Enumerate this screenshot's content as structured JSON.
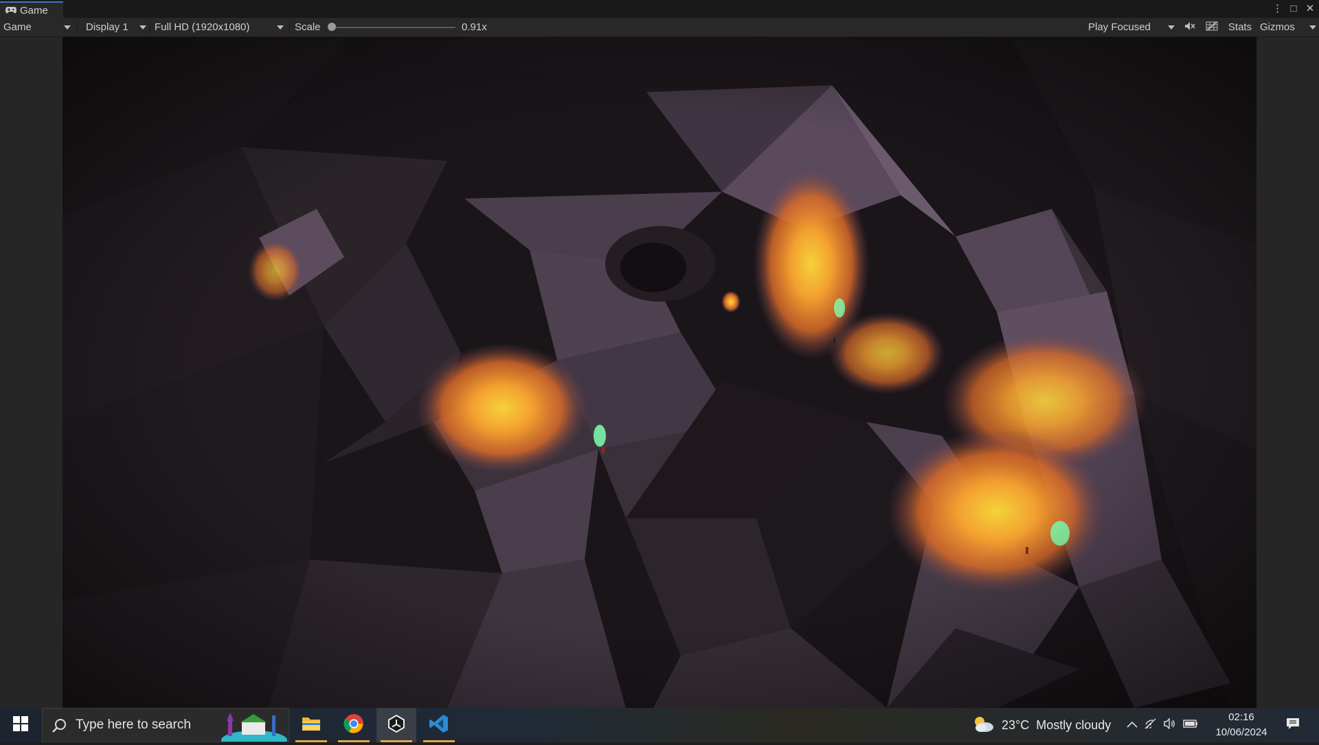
{
  "editor": {
    "tab_title": "Game",
    "window_controls": {
      "more": "⋮",
      "maximize": "□",
      "close": "✕"
    },
    "toolbar": {
      "view_mode": "Game",
      "display": "Display 1",
      "resolution": "Full HD (1920x1080)",
      "scale_label": "Scale",
      "scale_value": "0.91x",
      "scale_level": 0.0,
      "play_mode": "Play Focused",
      "stats_label": "Stats",
      "gizmos_label": "Gizmos"
    },
    "game_view": {
      "scene": "dark low-poly cave lit by glowing orange torches"
    }
  },
  "taskbar": {
    "search_placeholder": "Type here to search",
    "apps": [
      {
        "name": "File Explorer",
        "icon": "folder-icon",
        "active": false
      },
      {
        "name": "Google Chrome",
        "icon": "chrome-icon",
        "active": false
      },
      {
        "name": "Unity",
        "icon": "unity-icon",
        "active": true
      },
      {
        "name": "Visual Studio Code",
        "icon": "vscode-icon",
        "active": false
      }
    ],
    "weather": {
      "temperature": "23°C",
      "condition": "Mostly cloudy"
    },
    "clock": {
      "time": "02:16",
      "date": "10/06/2024"
    }
  },
  "colors": {
    "unity_panel": "#282828",
    "unity_tab_bar": "#191919",
    "unity_accent": "#3a79bb",
    "cave_rock": "#5a4a5c",
    "torch_glow": "#f08a2a",
    "flame": "#7dffb0"
  }
}
